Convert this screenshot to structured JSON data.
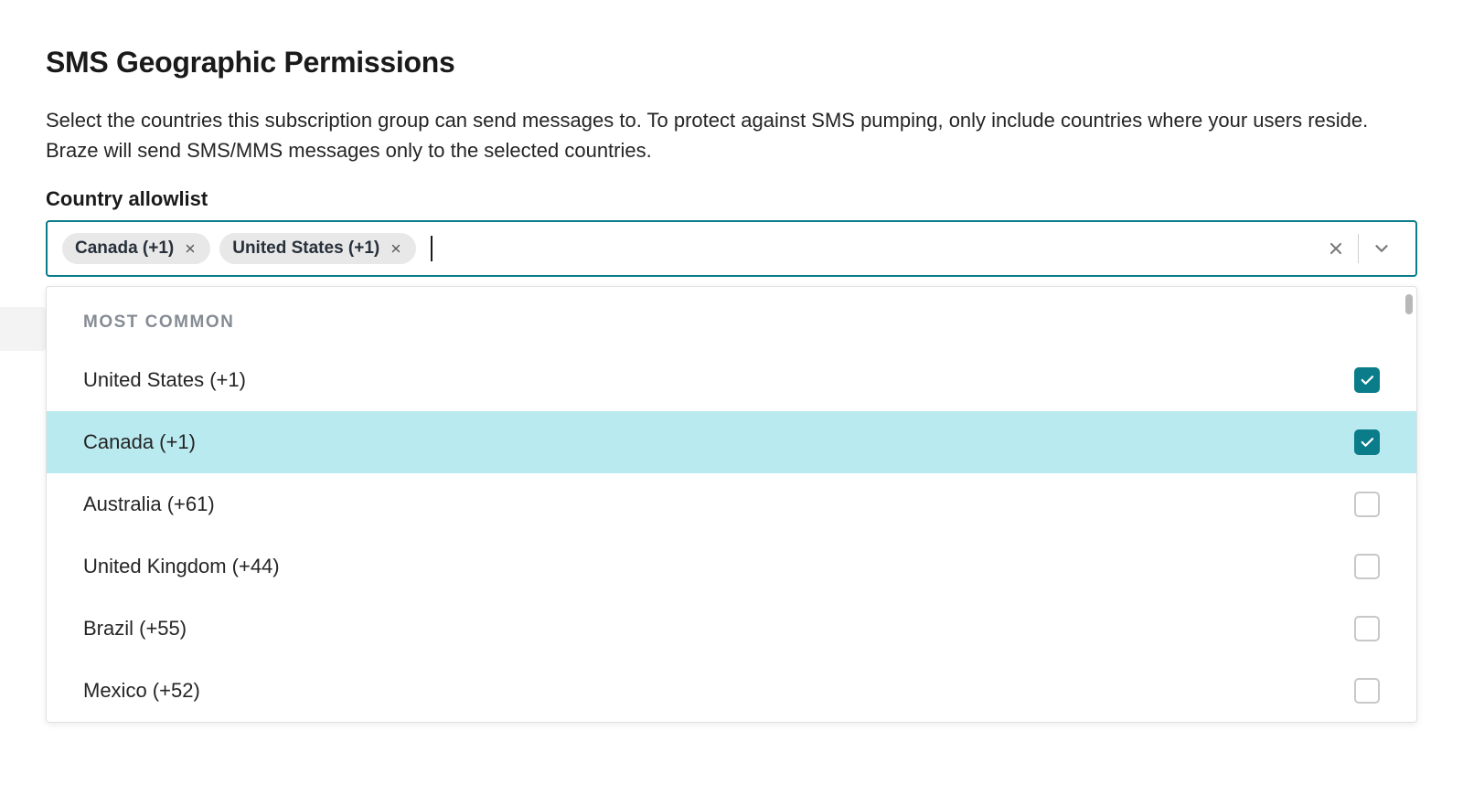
{
  "header": {
    "title": "SMS Geographic Permissions",
    "description": "Select the countries this subscription group can send messages to. To protect against SMS pumping, only include countries where your users reside. Braze will send SMS/MMS messages only to the selected countries."
  },
  "field": {
    "label": "Country allowlist"
  },
  "chips": [
    {
      "label": "Canada (+1)"
    },
    {
      "label": "United States (+1)"
    }
  ],
  "dropdown": {
    "group_header": "MOST COMMON",
    "options": [
      {
        "label": "United States (+1)",
        "checked": true,
        "highlighted": false
      },
      {
        "label": "Canada (+1)",
        "checked": true,
        "highlighted": true
      },
      {
        "label": "Australia (+61)",
        "checked": false,
        "highlighted": false
      },
      {
        "label": "United Kingdom (+44)",
        "checked": false,
        "highlighted": false
      },
      {
        "label": "Brazil (+55)",
        "checked": false,
        "highlighted": false
      },
      {
        "label": "Mexico (+52)",
        "checked": false,
        "highlighted": false
      }
    ]
  },
  "colors": {
    "accent": "#0a7c8a",
    "highlight": "#b9eaf0"
  }
}
